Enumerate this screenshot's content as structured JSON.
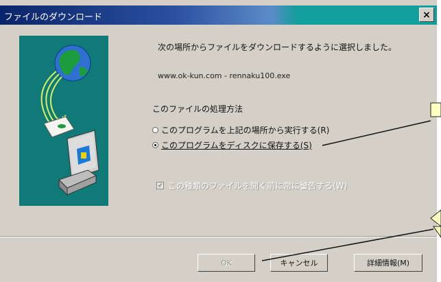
{
  "dialog": {
    "title": "ファイルのダウンロード",
    "close_label": "×",
    "message": "次の場所からファイルをダウンロードするように選択しました。",
    "url": "www.ok-kun.com - rennaku100.exe",
    "method_label": "このファイルの処理方法",
    "options": [
      {
        "label": "このプログラムを上記の場所から実行する(R)",
        "selected": false
      },
      {
        "label": "このプログラムをディスクに保存する(S)",
        "selected": true
      }
    ],
    "checkbox": {
      "label": "この種類のファイルを開く前に常に警告する(W)",
      "checked": true,
      "mark": "✓"
    },
    "buttons": {
      "ok": "OK",
      "cancel": "キャンセル",
      "details": "詳細情報(M)"
    }
  },
  "colors": {
    "dialog_bg": "#d4d0c8",
    "art_bg": "#0f7a78",
    "title_start": "#0a246a",
    "title_end": "#139e9e",
    "callout_fill": "#ffffc0"
  }
}
